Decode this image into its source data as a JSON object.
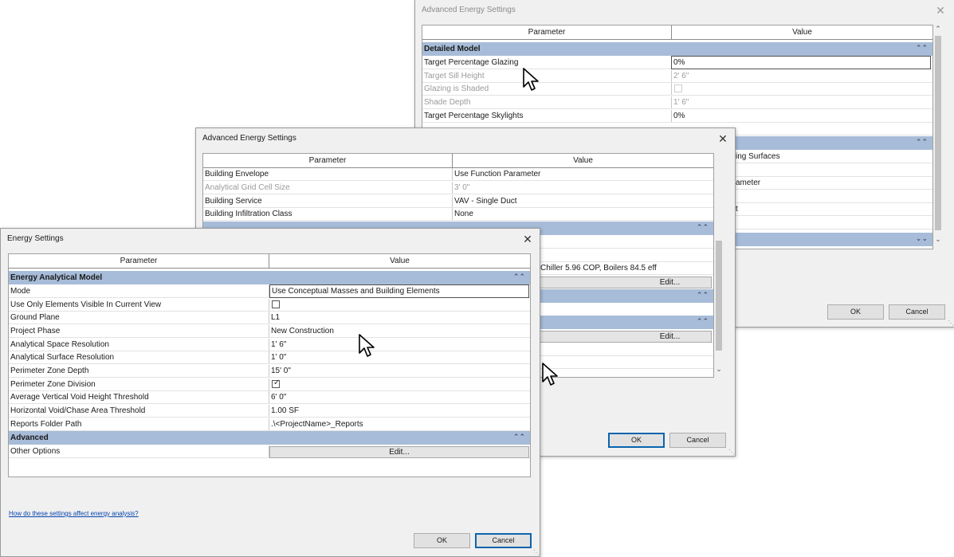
{
  "dialog3": {
    "title": "Advanced Energy Settings",
    "close_glyph": "✕",
    "header": {
      "param": "Parameter",
      "value": "Value"
    },
    "category": "Detailed Model",
    "rows": [
      {
        "param": "Target Percentage Glazing",
        "value": "0%"
      },
      {
        "param": "Target Sill Height",
        "value": "2'  6\""
      },
      {
        "param": "Glazing is Shaded",
        "value": ""
      },
      {
        "param": "Shade Depth",
        "value": "1'  6\""
      },
      {
        "param": "Target Percentage Skylights",
        "value": "0%"
      }
    ],
    "partial_values": [
      "ing Surfaces",
      "ameter",
      "t"
    ],
    "ok": "OK",
    "cancel": "Cancel"
  },
  "dialog2": {
    "title": "Advanced Energy Settings",
    "close_glyph": "✕",
    "header": {
      "param": "Parameter",
      "value": "Value"
    },
    "rows": [
      {
        "param": "Building Envelope",
        "value": "Use Function Parameter"
      },
      {
        "param": "Analytical Grid Cell Size",
        "value": "3'  0\""
      },
      {
        "param": "Building Service",
        "value": "VAV - Single Duct"
      },
      {
        "param": "Building Infiltration Class",
        "value": "None"
      }
    ],
    "hvac_value": "Chiller 5.96 COP, Boilers 84.5 eff",
    "edit1": "Edit...",
    "edit2": "Edit...",
    "ok": "OK",
    "cancel": "Cancel"
  },
  "dialog1": {
    "title": "Energy Settings",
    "close_glyph": "✕",
    "header": {
      "param": "Parameter",
      "value": "Value"
    },
    "category1": "Energy Analytical Model",
    "rows": [
      {
        "param": "Mode",
        "value": "Use Conceptual Masses and Building Elements"
      },
      {
        "param": "Use Only Elements Visible In Current View",
        "value": ""
      },
      {
        "param": "Ground Plane",
        "value": "L1"
      },
      {
        "param": "Project Phase",
        "value": "New Construction"
      },
      {
        "param": "Analytical Space Resolution",
        "value": "1'  6\""
      },
      {
        "param": "Analytical Surface Resolution",
        "value": "1'  0\""
      },
      {
        "param": "Perimeter Zone Depth",
        "value": "15'  0\""
      },
      {
        "param": "Perimeter Zone Division",
        "value": ""
      },
      {
        "param": "Average Vertical Void Height Threshold",
        "value": "6'  0\""
      },
      {
        "param": "Horizontal Void/Chase Area Threshold",
        "value": "1.00 SF"
      },
      {
        "param": "Reports Folder Path",
        "value": ".\\<ProjectName>_Reports"
      }
    ],
    "category2": "Advanced",
    "other_options": "Other Options",
    "edit": "Edit...",
    "help_link": "How do these settings affect energy analysis?",
    "ok": "OK",
    "cancel": "Cancel"
  },
  "icons": {
    "collapse": "chevron-double-up-icon",
    "expand": "chevron-double-down-icon",
    "close": "close-icon",
    "cursor": "mouse-pointer-icon"
  },
  "colors": {
    "category_band": "#a7bcd8",
    "link": "#0645ad",
    "default_button_border": "#0a64ad"
  }
}
